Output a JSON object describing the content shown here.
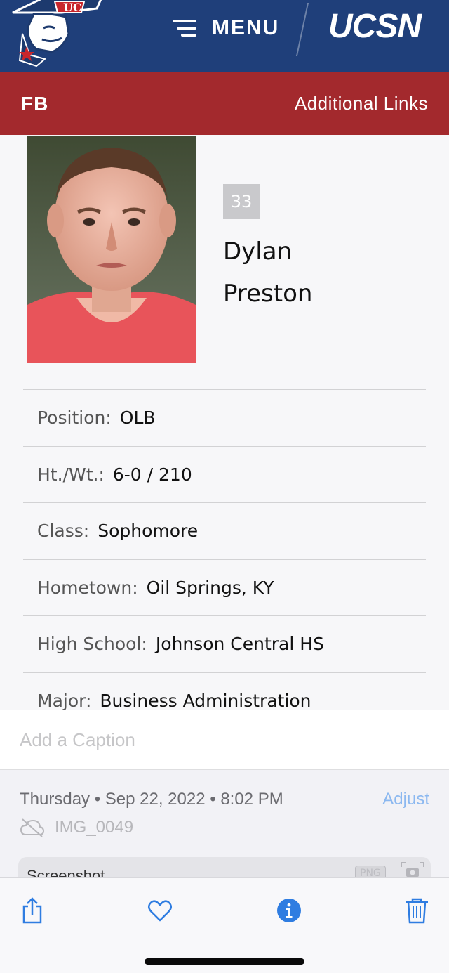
{
  "header": {
    "logo_text": "UC",
    "menu_label": "MENU",
    "brand": "UCSN"
  },
  "subnav": {
    "sport": "FB",
    "links_label": "Additional Links"
  },
  "player": {
    "number": "33",
    "first_name": "Dylan",
    "last_name": "Preston",
    "details": [
      {
        "label": "Position:",
        "value": "OLB"
      },
      {
        "label": "Ht./Wt.:",
        "value": "6-0 / 210"
      },
      {
        "label": "Class:",
        "value": "Sophomore"
      },
      {
        "label": "Hometown:",
        "value": "Oil Springs, KY"
      },
      {
        "label": "High School:",
        "value": "Johnson Central HS"
      },
      {
        "label": "Major:",
        "value": "Business Administration"
      }
    ]
  },
  "photo_info": {
    "caption_placeholder": "Add a Caption",
    "date": "Thursday • Sep 22, 2022 • 8:02 PM",
    "adjust_label": "Adjust",
    "file_name": "IMG_0049",
    "card_title": "Screenshot",
    "format_badge": "PNG"
  },
  "toolbar": {
    "icons": [
      "share-icon",
      "heart-icon",
      "info-icon",
      "trash-icon"
    ]
  },
  "colors": {
    "header_bg": "#1f3f7a",
    "subnav_bg": "#a3292d",
    "ios_blue": "#2f7de1"
  }
}
